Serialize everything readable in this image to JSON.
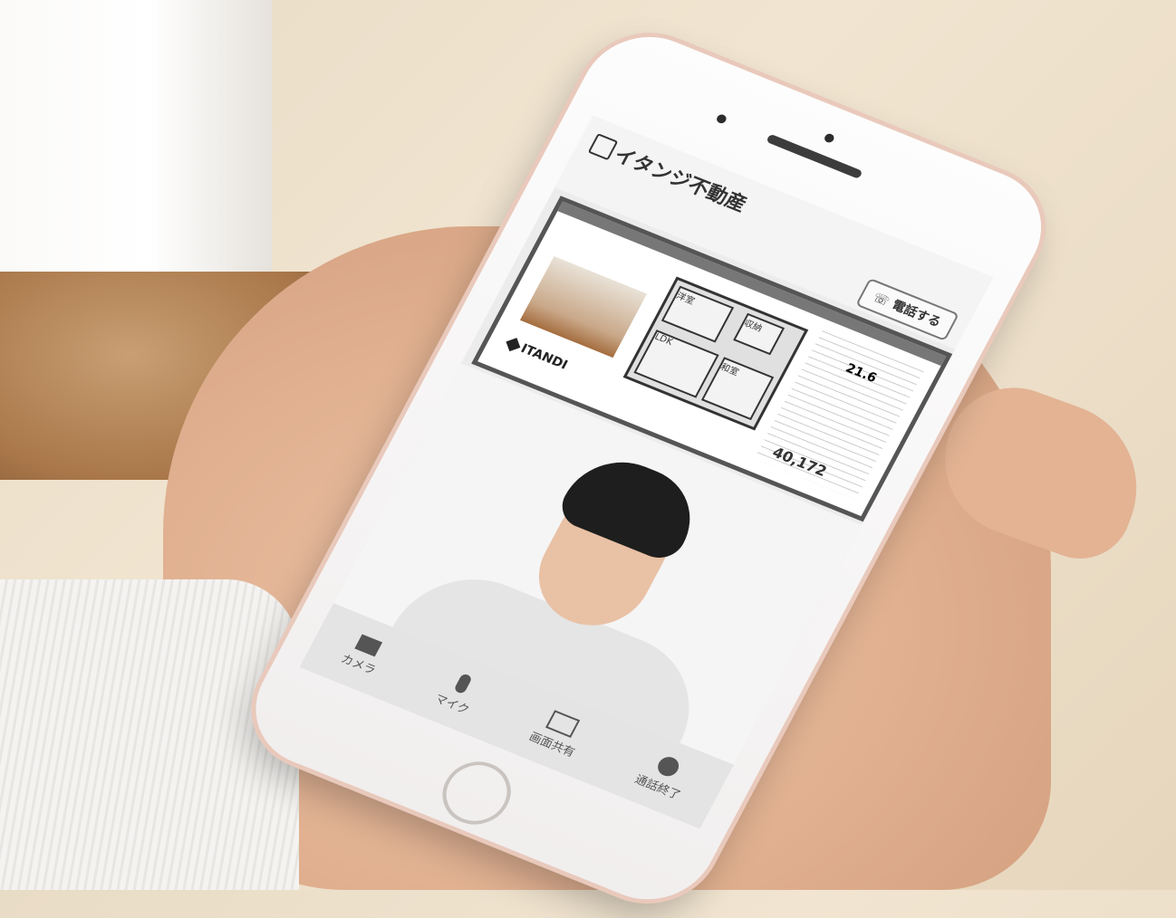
{
  "app": {
    "brand_name": "イタンジ不動産",
    "call_button_label": "電話する"
  },
  "listing": {
    "rooms": [
      "洋室",
      "LDK",
      "和室",
      "収納"
    ],
    "logo_text": "ITANDI",
    "price_text": "40,172",
    "area_text": "21.6"
  },
  "toolbar": {
    "items": [
      {
        "label": "カメラ",
        "icon": "camera-icon"
      },
      {
        "label": "マイク",
        "icon": "mic-icon"
      },
      {
        "label": "画面共有",
        "icon": "screen-share-icon"
      },
      {
        "label": "通話終了",
        "icon": "end-call-icon"
      }
    ]
  }
}
